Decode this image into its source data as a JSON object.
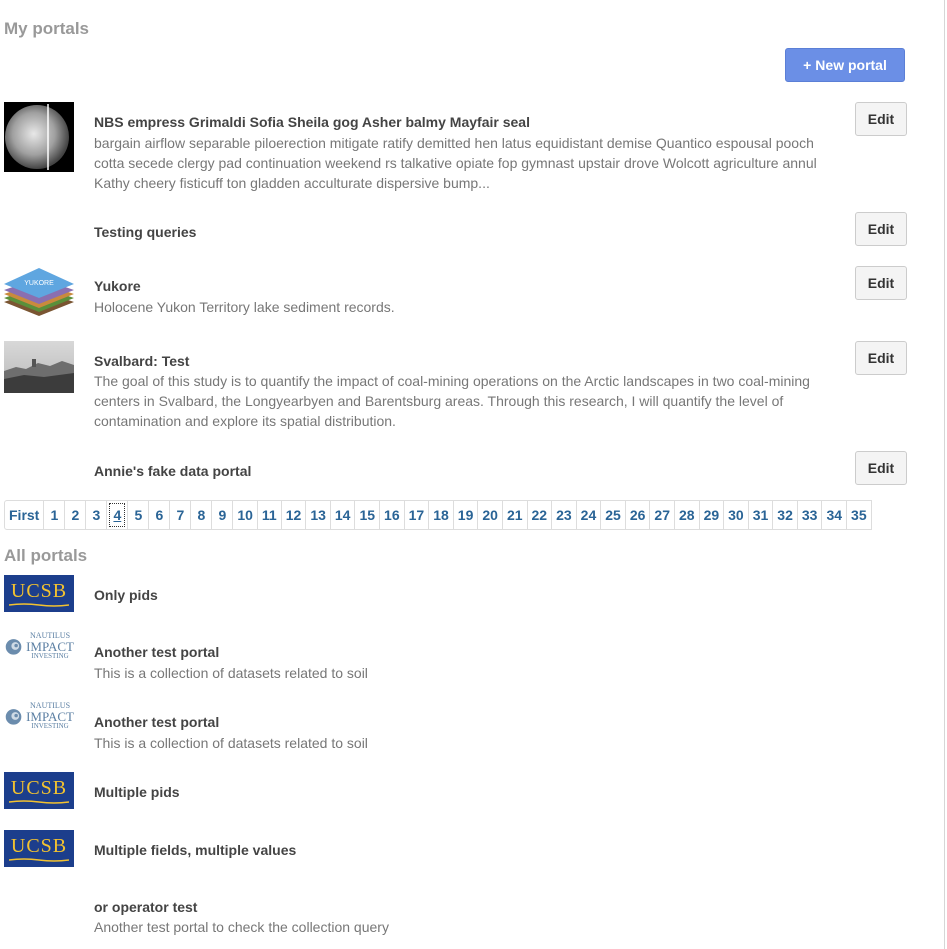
{
  "my_portals": {
    "heading": "My portals",
    "new_button": "New portal",
    "items": [
      {
        "title": "NBS empress Grimaldi Sofia Sheila gog Asher balmy Mayfair seal",
        "description": "bargain airflow separable piloerection mitigate ratify demitted hen latus equidistant demise Quantico espousal pooch cotta secede clergy pad continuation weekend rs talkative opiate fop gymnast upstair drove Wolcott agriculture annul Kathy cheery fisticuff ton gladden acculturate dispersive bump...",
        "edit": "Edit"
      },
      {
        "title": "Testing queries",
        "edit": "Edit"
      },
      {
        "title": "Yukore",
        "thumb_text": "YUKORE",
        "description": "Holocene Yukon Territory lake sediment records.",
        "edit": "Edit"
      },
      {
        "title": "Svalbard: Test",
        "description": "The goal of this study is to quantify the impact of coal-mining operations on the Arctic landscapes in two coal-mining centers in Svalbard, the Longyearbyen and Barentsburg areas. Through this research, I will quantify the level of contamination and explore its spatial distribution.",
        "edit": "Edit"
      },
      {
        "title": "Annie's fake data portal",
        "edit": "Edit"
      }
    ]
  },
  "pagination": {
    "first": "First",
    "pages": [
      "1",
      "2",
      "3",
      "4",
      "5",
      "6",
      "7",
      "8",
      "9",
      "10",
      "11",
      "12",
      "13",
      "14",
      "15",
      "16",
      "17",
      "18",
      "19",
      "20",
      "21",
      "22",
      "23",
      "24",
      "25",
      "26",
      "27",
      "28",
      "29",
      "30",
      "31",
      "32",
      "33",
      "34",
      "35"
    ],
    "current": "4"
  },
  "all_portals": {
    "heading": "All portals",
    "items": [
      {
        "title": "Only pids",
        "logo": "UCSB"
      },
      {
        "title": "Another test portal",
        "description": "This is a collection of datasets related to soil",
        "logo_lines": [
          "NAUTILUS",
          "IMPACT",
          "INVESTING"
        ]
      },
      {
        "title": "Another test portal",
        "description": "This is a collection of datasets related to soil",
        "logo_lines": [
          "NAUTILUS",
          "IMPACT",
          "INVESTING"
        ]
      },
      {
        "title": "Multiple pids",
        "logo": "UCSB"
      },
      {
        "title": "Multiple fields, multiple values",
        "logo": "UCSB"
      },
      {
        "title": "or operator test",
        "description": "Another test portal to check the collection query"
      }
    ]
  },
  "colors": {
    "accent": "#6b8fe6",
    "link": "#2a6496",
    "ucsb_blue": "#1c3e8c",
    "ucsb_gold": "#f2c230"
  }
}
